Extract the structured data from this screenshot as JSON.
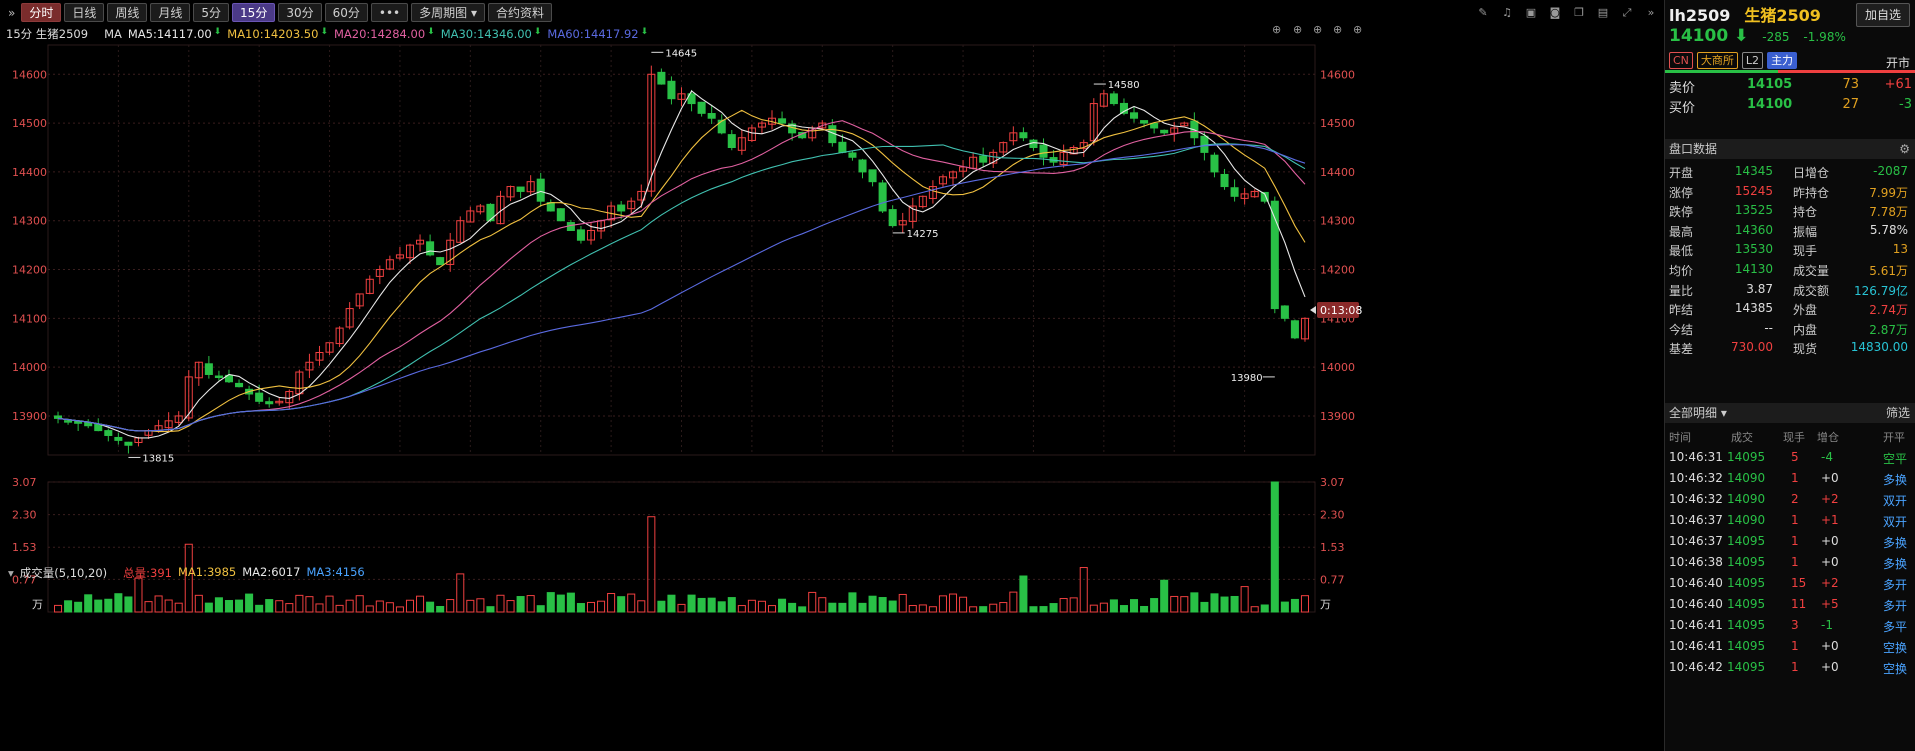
{
  "toolbar": {
    "collapse_icon": "»",
    "periods": [
      "分时",
      "日线",
      "周线",
      "月线",
      "5分",
      "15分",
      "30分",
      "60分",
      "•••",
      "多周期图 ▾",
      "合约资料"
    ],
    "active_index": 0,
    "selected_index": 5,
    "tool_icons": [
      "pencil-icon",
      "bell-icon",
      "lock-icon",
      "camera-icon",
      "window-icon",
      "layout-icon",
      "fullscreen-icon",
      "collapse-right-icon"
    ]
  },
  "ma_header": {
    "period": "15分 生猪2509",
    "ma_label": "MA",
    "items": [
      {
        "text": "MA5:14117.00",
        "color": "#e8e8e8"
      },
      {
        "text": "MA10:14203.50",
        "color": "#f0c040"
      },
      {
        "text": "MA20:14284.00",
        "color": "#e060a0"
      },
      {
        "text": "MA30:14346.00",
        "color": "#40c0b0"
      },
      {
        "text": "MA60:14417.92",
        "color": "#5a6ae0"
      }
    ]
  },
  "price_axis": {
    "labels": [
      "14600",
      "14500",
      "14400",
      "14300",
      "14200",
      "14100",
      "14000",
      "13900"
    ]
  },
  "annotations": {
    "high": "14645",
    "peak2": "14580",
    "low1": "14275",
    "low2": "13980",
    "start_low": "13815",
    "countdown": "0:13:08"
  },
  "volume_header": {
    "title": "成交量(5,10,20)",
    "items": [
      {
        "text": "总量:391",
        "color": "#f04040"
      },
      {
        "text": "MA1:3985",
        "color": "#f0c040"
      },
      {
        "text": "MA2:6017",
        "color": "#e8e8e8"
      },
      {
        "text": "MA3:4156",
        "color": "#4aa3ff"
      }
    ],
    "axis_labels": [
      "3.07",
      "2.30",
      "1.53",
      "0.77"
    ],
    "unit": "万"
  },
  "chart_data": {
    "type": "candlestick",
    "title": "",
    "ylim": [
      13820,
      14660
    ],
    "y_ticks": [
      14600,
      14500,
      14400,
      14300,
      14200,
      14100,
      14000,
      13900
    ],
    "close_series": [
      13895,
      13890,
      13885,
      13880,
      13870,
      13860,
      13850,
      13840,
      13855,
      13870,
      13880,
      13890,
      13900,
      13980,
      14010,
      13985,
      13980,
      13970,
      13960,
      13945,
      13930,
      13925,
      13930,
      13950,
      13990,
      14010,
      14030,
      14050,
      14080,
      14120,
      14150,
      14180,
      14200,
      14220,
      14230,
      14250,
      14260,
      14230,
      14210,
      14260,
      14300,
      14320,
      14330,
      14300,
      14350,
      14370,
      14360,
      14380,
      14340,
      14320,
      14300,
      14280,
      14260,
      14280,
      14300,
      14330,
      14320,
      14340,
      14360,
      14600,
      14580,
      14550,
      14560,
      14540,
      14520,
      14510,
      14480,
      14450,
      14470,
      14490,
      14500,
      14510,
      14500,
      14480,
      14470,
      14490,
      14500,
      14460,
      14440,
      14430,
      14400,
      14380,
      14320,
      14290,
      14300,
      14330,
      14350,
      14370,
      14390,
      14400,
      14410,
      14430,
      14420,
      14440,
      14460,
      14480,
      14470,
      14450,
      14430,
      14420,
      14440,
      14450,
      14460,
      14540,
      14560,
      14540,
      14520,
      14510,
      14500,
      14490,
      14480,
      14490,
      14500,
      14470,
      14440,
      14400,
      14370,
      14350,
      14355,
      14360,
      14340,
      14120,
      14100,
      14060,
      14100
    ],
    "highs": {
      "max": 14645,
      "local": 14580
    },
    "lows": {
      "min": 13815,
      "local1": 14275,
      "local2": 13980
    },
    "ma_series": {
      "MA5": 14117.0,
      "MA10": 14203.5,
      "MA20": 14284.0,
      "MA30": 14346.0,
      "MA60": 14417.92
    },
    "volume": {
      "ylim": [
        0,
        3.07
      ],
      "unit": "万",
      "spikes": [
        0.8,
        1.6,
        2.25,
        0.9,
        1.05,
        0.85,
        0.75,
        3.07,
        0.6
      ],
      "total": 391
    }
  },
  "quote": {
    "code": "lh2509",
    "name": "生猪2509",
    "add_label": "加自选",
    "price": "14100",
    "arrow": "⬇",
    "change": "-285",
    "pct": "-1.98%",
    "tags": [
      "CN",
      "大商所",
      "L2",
      "主力"
    ],
    "status": "开市",
    "sell": {
      "label": "卖价",
      "price": "14105",
      "vol": "73",
      "delta": "+61"
    },
    "buy": {
      "label": "买价",
      "price": "14100",
      "vol": "27",
      "delta": "-3"
    }
  },
  "board": {
    "title": "盘口数据",
    "rows": [
      {
        "l1": "开盘",
        "v1": "14345",
        "c1": "grn",
        "l2": "日增仓",
        "v2": "-2087",
        "c2": "grn"
      },
      {
        "l1": "涨停",
        "v1": "15245",
        "c1": "red",
        "l2": "昨持仓",
        "v2": "7.99万",
        "c2": "org"
      },
      {
        "l1": "跌停",
        "v1": "13525",
        "c1": "grn",
        "l2": "持仓",
        "v2": "7.78万",
        "c2": "org"
      },
      {
        "l1": "最高",
        "v1": "14360",
        "c1": "grn",
        "l2": "振幅",
        "v2": "5.78%",
        "c2": "wht"
      },
      {
        "l1": "最低",
        "v1": "13530",
        "c1": "grn",
        "l2": "现手",
        "v2": "13",
        "c2": "org"
      },
      {
        "l1": "均价",
        "v1": "14130",
        "c1": "grn",
        "l2": "成交量",
        "v2": "5.61万",
        "c2": "org"
      },
      {
        "l1": "量比",
        "v1": "3.87",
        "c1": "wht",
        "l2": "成交额",
        "v2": "126.79亿",
        "c2": "cyan"
      },
      {
        "l1": "昨结",
        "v1": "14385",
        "c1": "wht",
        "l2": "外盘",
        "v2": "2.74万",
        "c2": "red"
      },
      {
        "l1": "今结",
        "v1": "--",
        "c1": "wht",
        "l2": "内盘",
        "v2": "2.87万",
        "c2": "grn"
      },
      {
        "l1": "基差",
        "v1": "730.00",
        "c1": "red",
        "l2": "现货",
        "v2": "14830.00",
        "c2": "cyan"
      }
    ]
  },
  "trades": {
    "title": "全部明细 ▾",
    "filter": "筛选",
    "headers": [
      "时间",
      "成交",
      "现手",
      "增仓",
      "开平"
    ],
    "rows": [
      {
        "t": "10:46:31",
        "p": "14095",
        "v": "5",
        "d": "-4",
        "dc": "grn",
        "k": "空平",
        "kc": "grn"
      },
      {
        "t": "10:46:32",
        "p": "14090",
        "v": "1",
        "d": "+0",
        "dc": "wht",
        "k": "多换",
        "kc": "blu"
      },
      {
        "t": "10:46:32",
        "p": "14090",
        "v": "2",
        "d": "+2",
        "dc": "red",
        "k": "双开",
        "kc": "blu"
      },
      {
        "t": "10:46:37",
        "p": "14090",
        "v": "1",
        "d": "+1",
        "dc": "red",
        "k": "双开",
        "kc": "blu"
      },
      {
        "t": "10:46:37",
        "p": "14095",
        "v": "1",
        "d": "+0",
        "dc": "wht",
        "k": "多换",
        "kc": "blu"
      },
      {
        "t": "10:46:38",
        "p": "14095",
        "v": "1",
        "d": "+0",
        "dc": "wht",
        "k": "多换",
        "kc": "blu"
      },
      {
        "t": "10:46:40",
        "p": "14095",
        "v": "15",
        "d": "+2",
        "dc": "red",
        "k": "多开",
        "kc": "blu"
      },
      {
        "t": "10:46:40",
        "p": "14095",
        "v": "11",
        "d": "+5",
        "dc": "red",
        "k": "多开",
        "kc": "blu"
      },
      {
        "t": "10:46:41",
        "p": "14095",
        "v": "3",
        "d": "-1",
        "dc": "grn",
        "k": "多平",
        "kc": "blu"
      },
      {
        "t": "10:46:41",
        "p": "14095",
        "v": "1",
        "d": "+0",
        "dc": "wht",
        "k": "空换",
        "kc": "blu"
      },
      {
        "t": "10:46:42",
        "p": "14095",
        "v": "1",
        "d": "+0",
        "dc": "wht",
        "k": "空换",
        "kc": "blu"
      }
    ]
  }
}
